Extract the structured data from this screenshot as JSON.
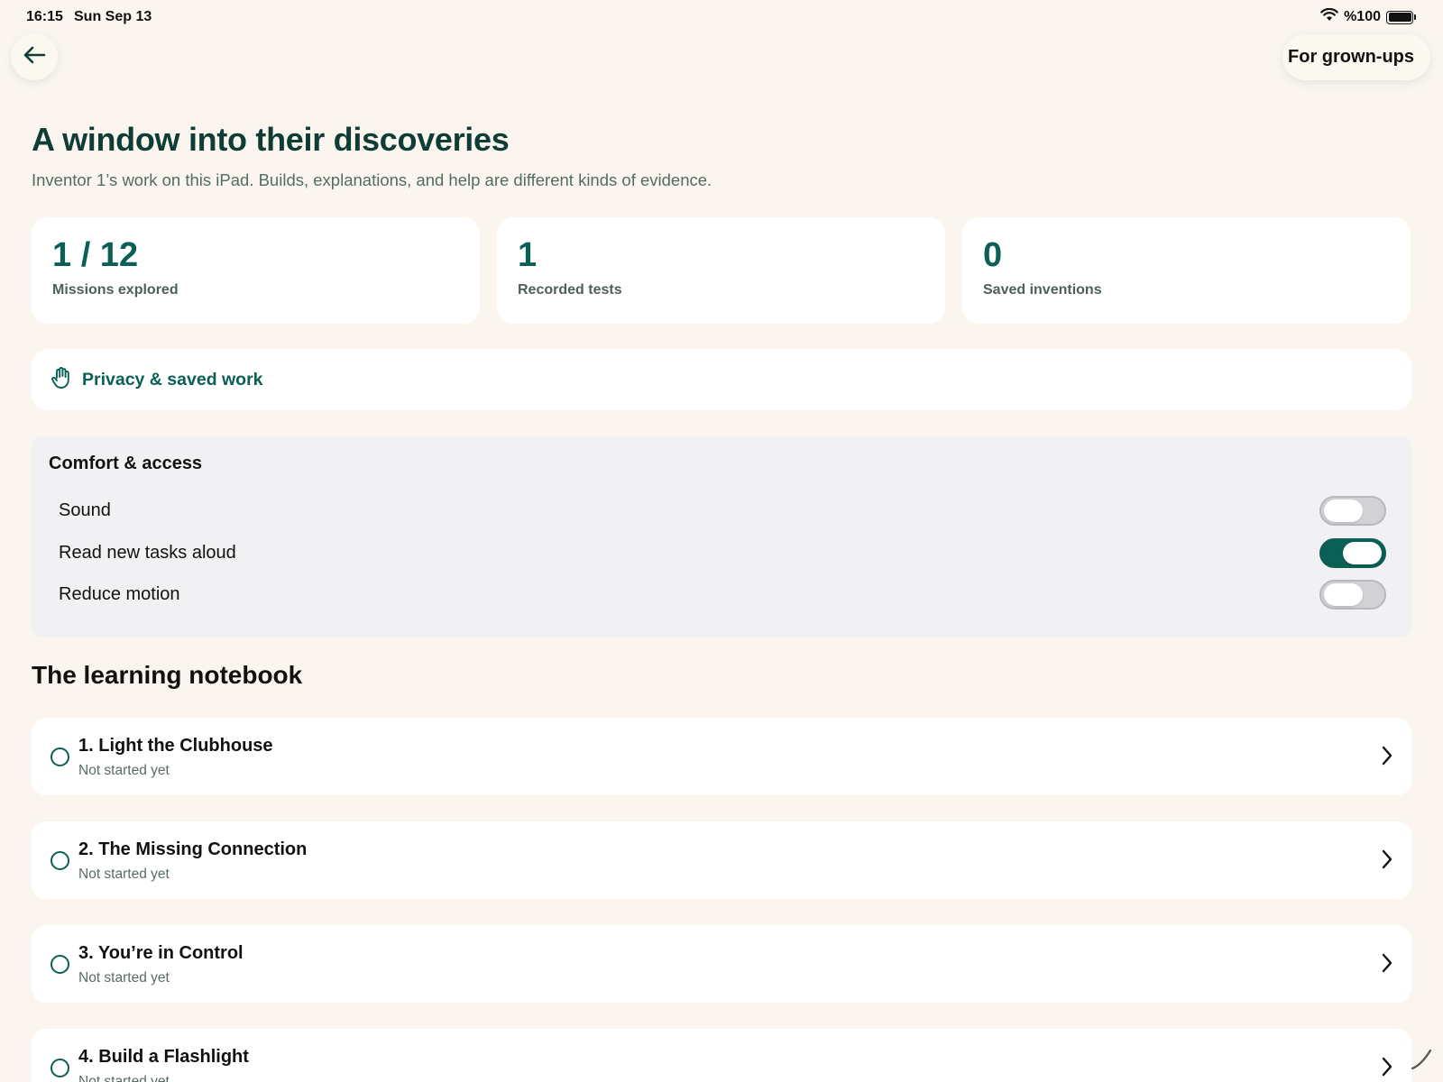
{
  "status_bar": {
    "time": "16:15",
    "date": "Sun Sep 13",
    "battery": "%100"
  },
  "nav": {
    "back_icon": "arrow-left-icon",
    "grownups_label": "For grown-ups"
  },
  "header": {
    "title": "A window into their discoveries",
    "subtitle": "Inventor 1’s work on this iPad. Builds, explanations, and help are different kinds of evidence."
  },
  "stats": [
    {
      "value": "1 / 12",
      "label": "Missions explored"
    },
    {
      "value": "1",
      "label": "Recorded tests"
    },
    {
      "value": "0",
      "label": "Saved inventions"
    }
  ],
  "privacy": {
    "icon": "hand-icon",
    "label": "Privacy & saved work"
  },
  "comfort": {
    "title": "Comfort & access",
    "toggles": [
      {
        "label": "Sound",
        "on": false
      },
      {
        "label": "Read new tasks aloud",
        "on": true
      },
      {
        "label": "Reduce motion",
        "on": false
      }
    ]
  },
  "notebook": {
    "title": "The learning notebook",
    "missions": [
      {
        "title": "1. Light the Clubhouse",
        "status": "Not started yet"
      },
      {
        "title": "2. The Missing Connection",
        "status": "Not started yet"
      },
      {
        "title": "3. You’re in Control",
        "status": "Not started yet"
      },
      {
        "title": "4. Build a Flashlight",
        "status": "Not started yet"
      }
    ]
  },
  "colors": {
    "accent": "#0b5f55",
    "title": "#0f3d36",
    "background": "#faf6ef",
    "panel": "#f1f1f4"
  }
}
